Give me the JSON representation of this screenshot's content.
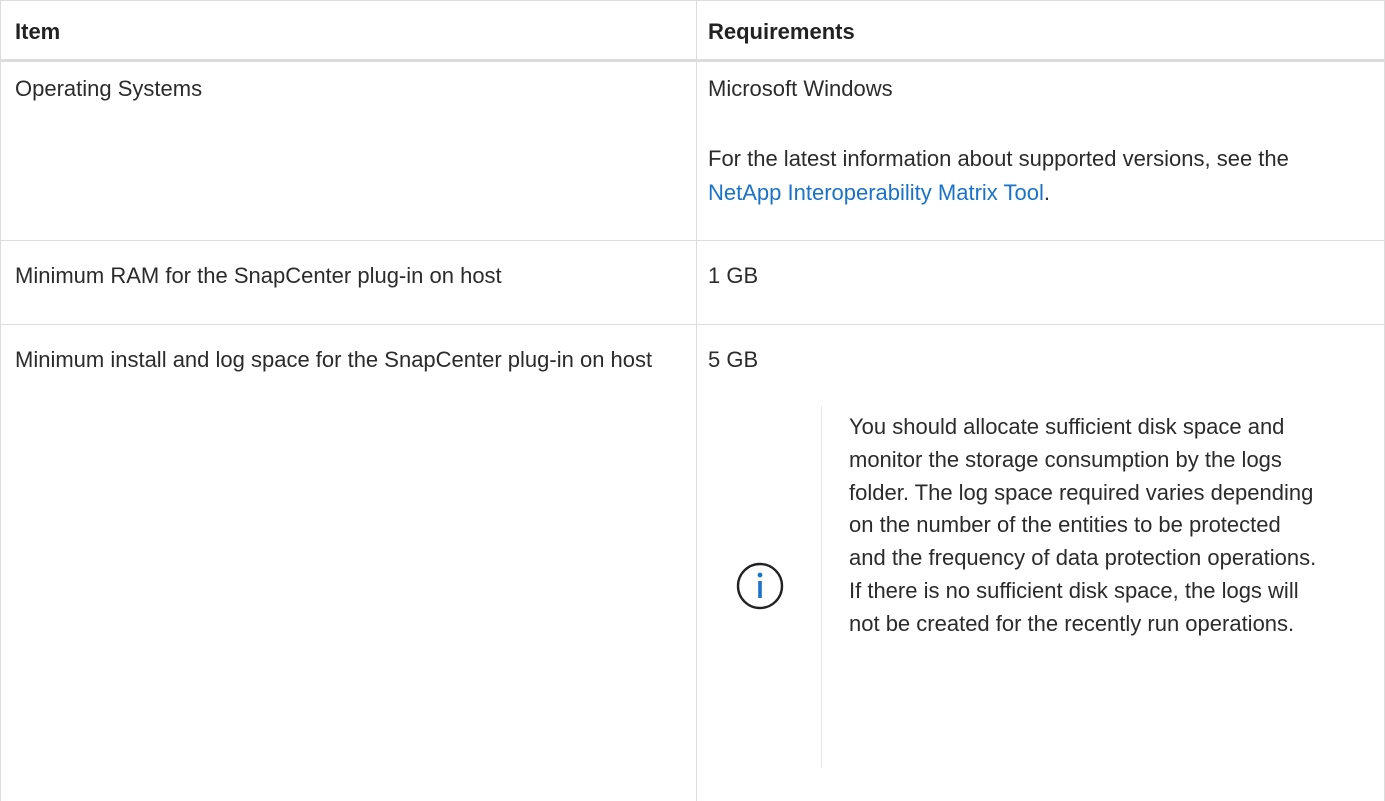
{
  "table": {
    "headers": {
      "item": "Item",
      "requirements": "Requirements"
    },
    "rows": [
      {
        "item": "Operating Systems",
        "requirement": "Microsoft Windows",
        "detail_prefix": "For the latest information about supported versions, see the ",
        "detail_link": "NetApp Interoperability Matrix Tool",
        "detail_suffix": "."
      },
      {
        "item": "Minimum RAM for the SnapCenter plug-in on host",
        "requirement": "1 GB"
      },
      {
        "item": "Minimum install and log space for the SnapCenter plug-in on host",
        "requirement": "5 GB",
        "note_icon": "info-icon",
        "note": "You should allocate sufficient disk space and monitor the storage consumption by the logs folder. The log space required varies depending on the number of the entities to be protected and the frequency of data protection operations. If there is no sufficient disk space, the logs will not be created for the recently run operations."
      }
    ]
  },
  "colors": {
    "link": "#1a73c9",
    "border": "#dcdcdc",
    "text": "#2b2b2b",
    "icon": "#222222",
    "icon_dot": "#1a73c9"
  }
}
